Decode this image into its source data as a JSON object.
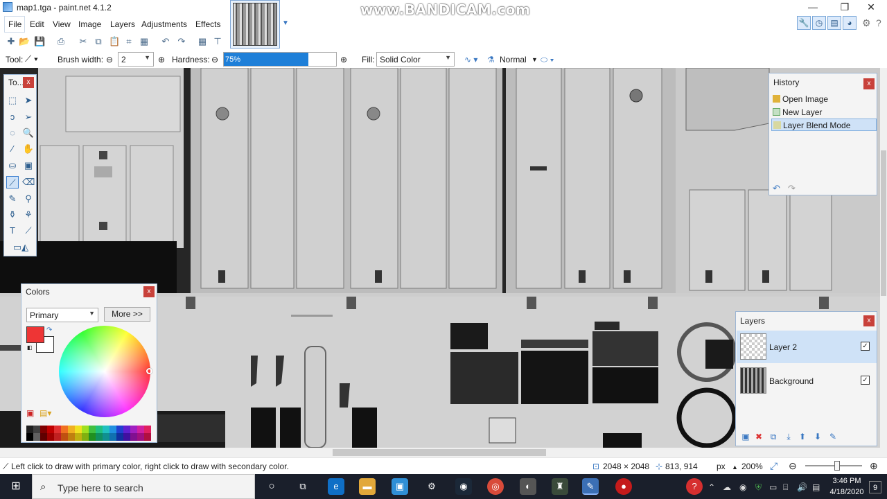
{
  "window": {
    "title": "map1.tga - paint.net 4.1.2",
    "controls": {
      "minimize": "—",
      "maximize": "❐",
      "close": "✕"
    }
  },
  "watermark": "www.BANDICAM.com",
  "menu": [
    "File",
    "Edit",
    "View",
    "Image",
    "Layers",
    "Adjustments",
    "Effects"
  ],
  "toolbar": {
    "tool_label": "Tool:",
    "brush_width_label": "Brush width:",
    "brush_width_value": "2",
    "hardness_label": "Hardness:",
    "hardness_value": "75%",
    "hardness_fraction": 0.75,
    "fill_label": "Fill:",
    "fill_value": "Solid Color",
    "blend_mode": "Normal"
  },
  "tools_panel": {
    "title": "To...",
    "close": "x"
  },
  "colors_panel": {
    "title": "Colors",
    "close": "x",
    "mode": "Primary",
    "more_button": "More >>",
    "primary_color": "#ee3535",
    "secondary_color": "#ffffff",
    "palette": [
      "#202020",
      "#404040",
      "#800000",
      "#c00000",
      "#e03030",
      "#f07020",
      "#f0b020",
      "#f0e020",
      "#a0e020",
      "#40c040",
      "#20c080",
      "#20c0c0",
      "#2090e0",
      "#2040d0",
      "#6020d0",
      "#a020c0",
      "#d020a0",
      "#e02060",
      "#000000",
      "#606060",
      "#600000",
      "#a00000",
      "#c02020",
      "#c05010",
      "#c08010",
      "#c0b010",
      "#80b010",
      "#209020",
      "#109060",
      "#109090",
      "#1070b0",
      "#1030a0",
      "#4010a0",
      "#801090",
      "#a01080",
      "#b01040"
    ]
  },
  "history_panel": {
    "title": "History",
    "close": "x",
    "items": [
      {
        "label": "Open Image",
        "selected": false
      },
      {
        "label": "New Layer",
        "selected": false
      },
      {
        "label": "Layer Blend Mode",
        "selected": true
      }
    ]
  },
  "layers_panel": {
    "title": "Layers",
    "close": "x",
    "layers": [
      {
        "name": "Layer 2",
        "visible": true,
        "selected": true
      },
      {
        "name": "Background",
        "visible": true,
        "selected": false
      }
    ]
  },
  "status": {
    "hint": "Left click to draw with primary color, right click to draw with secondary color.",
    "image_size": "2048 × 2048",
    "cursor_pos": "813, 914",
    "units": "px",
    "zoom": "200%"
  },
  "taskbar": {
    "search_placeholder": "Type here to search",
    "time": "3:46 PM",
    "date": "4/18/2020",
    "notifications": "9"
  }
}
